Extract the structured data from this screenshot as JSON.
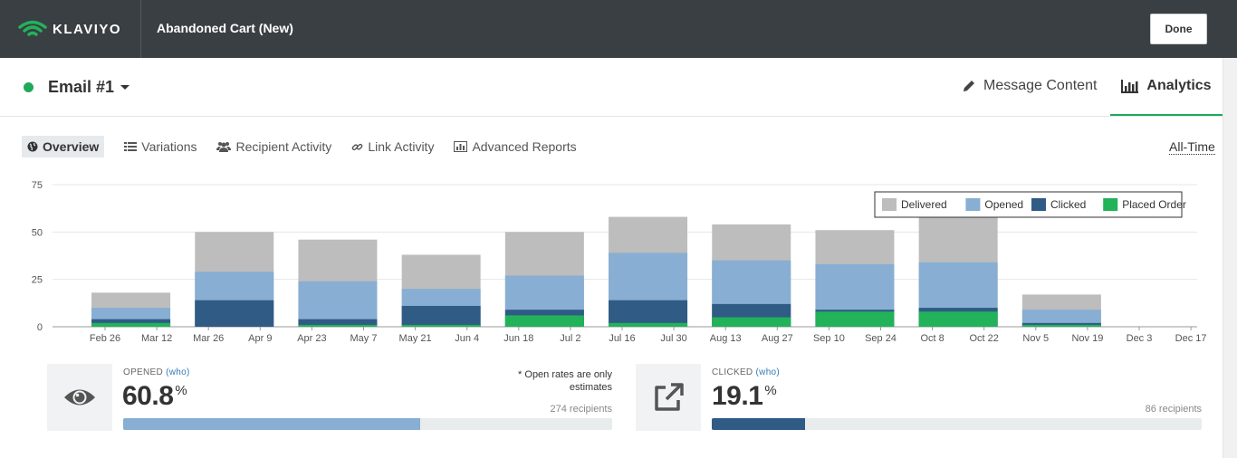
{
  "app": {
    "brand": "KLAVIYO",
    "flow_title": "Abandoned Cart (New)",
    "done_label": "Done"
  },
  "header": {
    "email_name": "Email #1",
    "message_content_label": "Message Content",
    "analytics_label": "Analytics"
  },
  "subnav": {
    "items": [
      {
        "label": "Overview",
        "icon": "globe-icon",
        "active": true
      },
      {
        "label": "Variations",
        "icon": "list-icon",
        "active": false
      },
      {
        "label": "Recipient Activity",
        "icon": "users-icon",
        "active": false
      },
      {
        "label": "Link Activity",
        "icon": "link-icon",
        "active": false
      },
      {
        "label": "Advanced Reports",
        "icon": "bar-chart-icon",
        "active": false
      }
    ],
    "range_label": "All-Time"
  },
  "colors": {
    "delivered": "#bdbdbd",
    "opened": "#88aed3",
    "clicked": "#2f5b85",
    "placed_order": "#22b25a",
    "accent": "#1eaa5a",
    "topbar": "#3a3f44"
  },
  "chart_data": {
    "type": "bar",
    "stacked": "overlay",
    "ylim": [
      0,
      75
    ],
    "yticks": [
      0,
      25,
      50,
      75
    ],
    "grid": true,
    "legend_position": "top-right",
    "x_ticks": [
      "Feb 26",
      "Mar 12",
      "Mar 26",
      "Apr 9",
      "Apr 23",
      "May 7",
      "May 21",
      "Jun 4",
      "Jun 18",
      "Jul 2",
      "Jul 16",
      "Jul 30",
      "Aug 13",
      "Aug 27",
      "Sep 10",
      "Sep 24",
      "Oct 8",
      "Oct 22",
      "Nov 5",
      "Nov 19",
      "Dec 3",
      "Dec 17"
    ],
    "bar_positions": [
      "Mar 5",
      "Apr 2",
      "Apr 30",
      "May 28",
      "Jun 25",
      "Jul 23",
      "Aug 20",
      "Sep 17",
      "Oct 15",
      "Nov 12",
      "Dec 10"
    ],
    "series": [
      {
        "name": "Delivered",
        "values": [
          18,
          50,
          46,
          38,
          50,
          58,
          54,
          51,
          65,
          17,
          0
        ]
      },
      {
        "name": "Opened",
        "values": [
          10,
          29,
          24,
          20,
          27,
          39,
          35,
          33,
          34,
          9,
          0
        ]
      },
      {
        "name": "Clicked",
        "values": [
          4,
          14,
          4,
          11,
          9,
          14,
          12,
          9,
          10,
          2,
          0
        ]
      },
      {
        "name": "Placed Order",
        "values": [
          2,
          0,
          1,
          1,
          6,
          2,
          5,
          8,
          8,
          1,
          0
        ]
      }
    ]
  },
  "stats": {
    "opened": {
      "label": "OPENED",
      "who": "(who)",
      "value": "60.8",
      "unit": "%",
      "note_line1": "* Open rates are only",
      "note_line2": "estimates",
      "recipients": "274 recipients",
      "fraction": 0.608
    },
    "clicked": {
      "label": "CLICKED",
      "who": "(who)",
      "value": "19.1",
      "unit": "%",
      "recipients": "86 recipients",
      "fraction": 0.191
    }
  }
}
